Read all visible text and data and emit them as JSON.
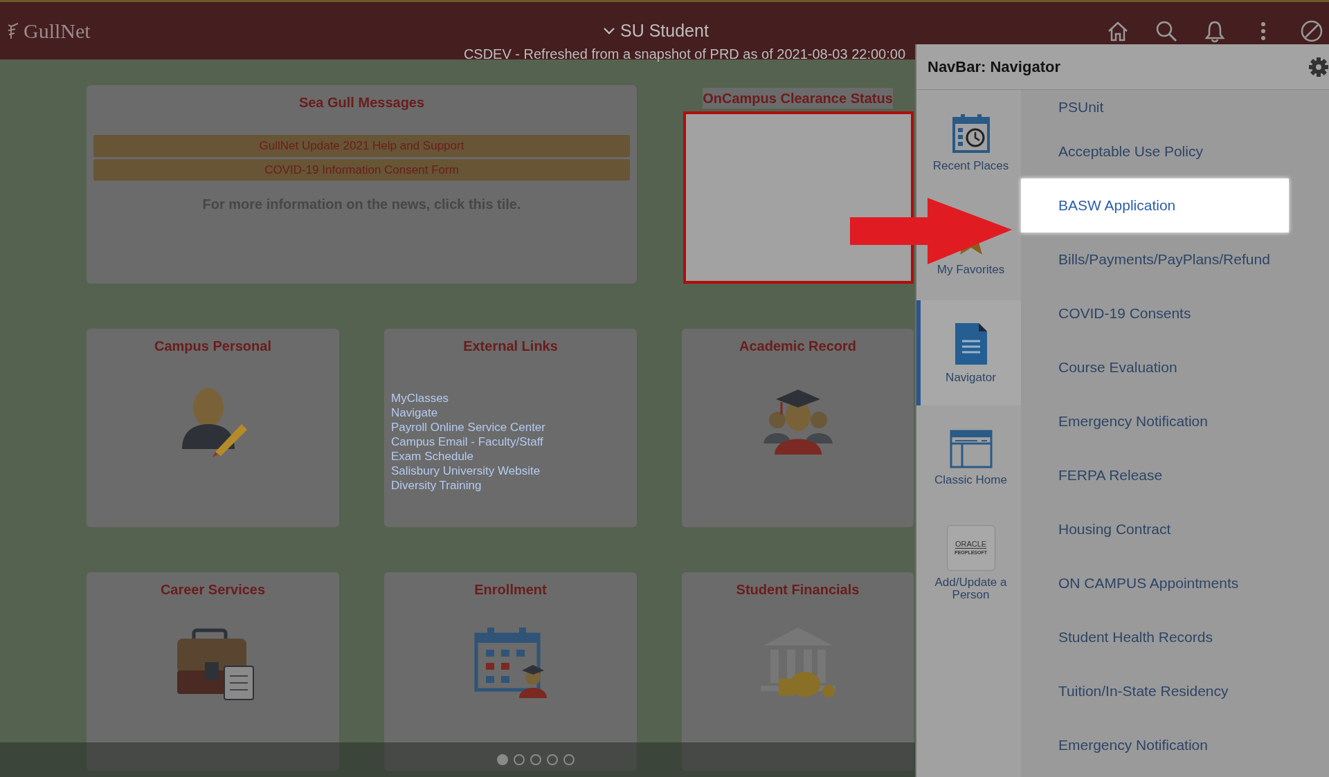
{
  "header": {
    "logo": "GullNet",
    "title": "SU Student",
    "notice": "CSDEV - Refreshed from a snapshot of PRD as of 2021-08-03 22:00:00"
  },
  "tiles": [
    {
      "kind": "messages",
      "title": "Sea Gull Messages",
      "buttons": [
        "GullNet Update 2021 Help and Support",
        "COVID-19 Information Consent Form"
      ],
      "note": "For more information on the news, click this tile."
    },
    {
      "kind": "blank",
      "title": "OnCampus Clearance Status",
      "outlined": true
    },
    {
      "kind": "picture",
      "title": "Campus Personal"
    },
    {
      "kind": "links",
      "title": "External Links",
      "links": [
        "MyClasses",
        "Navigate",
        "Payroll Online Service Center",
        "Campus Email - Faculty/Staff",
        "Exam Schedule",
        "Salisbury University Website",
        "Diversity Training"
      ]
    },
    {
      "kind": "picture",
      "title": "Academic Record"
    },
    {
      "kind": "picture",
      "title": "Career Services"
    },
    {
      "kind": "picture",
      "title": "Enrollment"
    },
    {
      "kind": "picture",
      "title": "Student Financials"
    }
  ],
  "pager": [
    {
      "selected": true
    },
    {
      "selected": false
    },
    {
      "selected": false
    },
    {
      "selected": false
    },
    {
      "selected": false
    }
  ],
  "panel": {
    "title": "NavBar: Navigator",
    "nav_items": [
      {
        "label": "Recent Places",
        "selected": false
      },
      {
        "label": "My Favorites",
        "selected": false
      },
      {
        "label": "Navigator",
        "selected": true
      },
      {
        "label": "Classic Home",
        "selected": false
      },
      {
        "label": "Add/Update a Person",
        "selected": false,
        "logo_text": [
          "ORACLE",
          "PEOPLESOFT"
        ]
      }
    ],
    "menu_items": [
      {
        "label": "PSUnit",
        "highlighted": false
      },
      {
        "label": "Acceptable Use Policy",
        "highlighted": false
      },
      {
        "label": "BASW Application",
        "highlighted": true
      },
      {
        "label": "Bills/Payments/PayPlans/Refund",
        "highlighted": false
      },
      {
        "label": "COVID-19 Consents",
        "highlighted": false
      },
      {
        "label": "Course Evaluation",
        "highlighted": false
      },
      {
        "label": "Emergency Notification",
        "highlighted": false
      },
      {
        "label": "FERPA Release",
        "highlighted": false
      },
      {
        "label": "Housing Contract",
        "highlighted": false
      },
      {
        "label": "ON CAMPUS Appointments",
        "highlighted": false
      },
      {
        "label": "Student Health Records",
        "highlighted": false
      },
      {
        "label": "Tuition/In-State Residency",
        "highlighted": false
      },
      {
        "label": "Emergency Notification",
        "highlighted": false
      }
    ]
  }
}
